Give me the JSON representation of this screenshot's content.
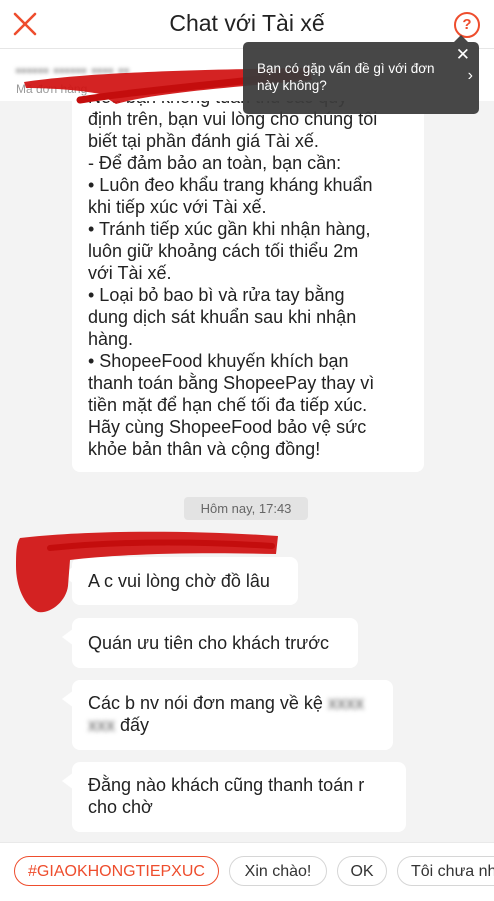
{
  "header": {
    "title": "Chat với Tài xế",
    "help_symbol": "?"
  },
  "order_bar": {
    "order_id_blurred": "•••••• •••••• •••• ••",
    "label": "Mã đơn hàng"
  },
  "tooltip": {
    "text": "Bạn có gặp vấn đề gì với đơn này không?",
    "close_symbol": "✕",
    "chevron_symbol": "›"
  },
  "messages": {
    "system_notice_lines": [
      "Nếu bạn không tuân thủ các quy",
      "định trên, bạn vui lòng cho chúng tôi",
      "biết tại phần đánh giá Tài xế.",
      "- Để đảm bảo an toàn, bạn cần:",
      "• Luôn đeo khẩu trang kháng khuẩn",
      "khi tiếp xúc với Tài xế.",
      "• Tránh tiếp xúc gần khi nhận hàng,",
      "luôn giữ khoảng cách tối thiểu 2m",
      "với Tài xế.",
      " • Loại bỏ bao bì và rửa tay bằng",
      "dung dịch sát khuẩn sau khi nhận",
      "hàng.",
      "• ShopeeFood khuyến khích bạn",
      "thanh toán bằng ShopeePay thay vì",
      "tiền mặt để hạn chế tối đa tiếp xúc.",
      "Hãy cùng ShopeeFood bảo vệ sức",
      "khỏe bản thân và cộng đồng!"
    ],
    "timestamp": "Hôm nay, 17:43",
    "driver_messages": [
      {
        "text": "A c vui lòng chờ đồ lâu"
      },
      {
        "text": "Quán ưu tiên cho khách trước"
      },
      {
        "text_start": "Các b nv nói đơn mang về kệ",
        "blurred_1": "xxxx",
        "blurred_2": "xxx",
        "text_end": "đấy"
      },
      {
        "line1": "Đằng nào khách cũng thanh toán r",
        "line2": "cho chờ"
      }
    ]
  },
  "quick_replies": [
    "#GIAOKHONGTIEPXUC",
    "Xin chào!",
    "OK",
    "Tôi chưa nhận"
  ],
  "colors": {
    "accent": "#ee4d2d",
    "background": "#f3f3f3",
    "tooltip": "#3c3c3c",
    "redaction": "#d01010"
  }
}
